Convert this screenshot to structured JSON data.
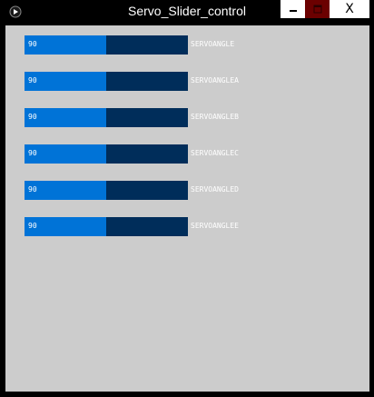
{
  "window": {
    "title": "Servo_Slider_control",
    "colors": {
      "frame": "#000000",
      "client_bg": "#cccccc",
      "track": "#002d5a",
      "fill": "#0073d7",
      "maximize_bg": "#6b0000"
    }
  },
  "controls": {
    "minimize_icon": "minimize-icon",
    "maximize_icon": "maximize-icon",
    "close_label": "X"
  },
  "sliders": [
    {
      "value": "90",
      "label": "SERVOANGLE",
      "fraction": 0.5
    },
    {
      "value": "90",
      "label": "SERVOANGLEA",
      "fraction": 0.5
    },
    {
      "value": "90",
      "label": "SERVOANGLEB",
      "fraction": 0.5
    },
    {
      "value": "90",
      "label": "SERVOANGLEC",
      "fraction": 0.5
    },
    {
      "value": "90",
      "label": "SERVOANGLED",
      "fraction": 0.5
    },
    {
      "value": "90",
      "label": "SERVOANGLEE",
      "fraction": 0.5
    }
  ]
}
